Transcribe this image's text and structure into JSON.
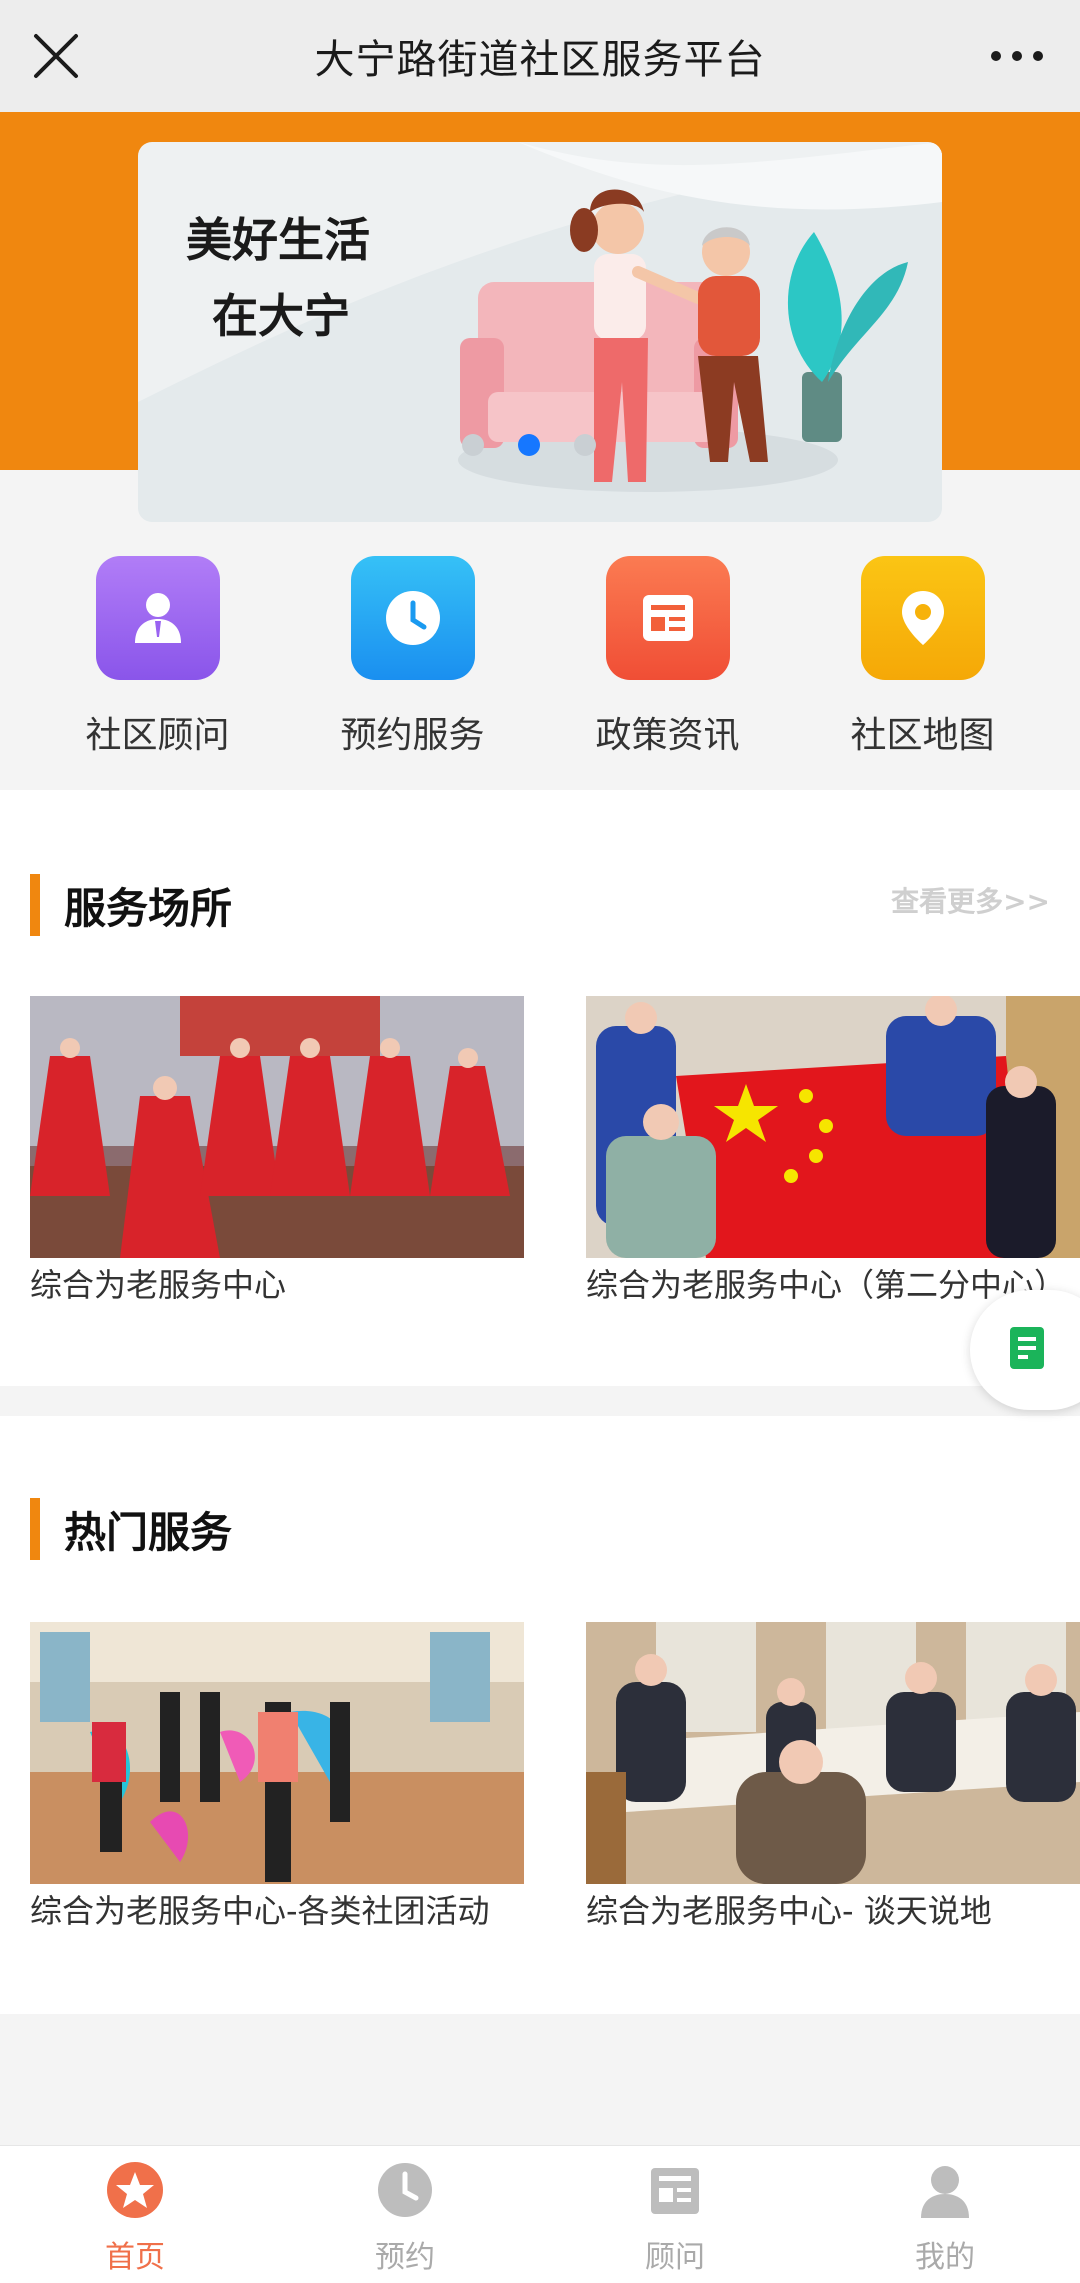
{
  "topbar": {
    "title": "大宁路街道社区服务平台",
    "close_icon": "close-icon",
    "more_icon": "more-icon"
  },
  "banner": {
    "line1": "美好生活",
    "line2": "在大宁",
    "slide_count": 3,
    "active_slide": 2,
    "colors": {
      "background": "#f0870f",
      "dot_active": "#1677ff"
    }
  },
  "quick_actions": [
    {
      "label": "社区顾问",
      "icon": "consultant-icon",
      "color": "#9a63f1"
    },
    {
      "label": "预约服务",
      "icon": "clock-icon",
      "color": "#1aa6f0"
    },
    {
      "label": "政策资讯",
      "icon": "news-icon",
      "color": "#f2603a"
    },
    {
      "label": "社区地图",
      "icon": "location-pin-icon",
      "color": "#f7b20a"
    }
  ],
  "venues": {
    "title": "服务场所",
    "more": "查看更多>>",
    "items": [
      {
        "caption": "综合为老服务中心"
      },
      {
        "caption": "综合为老服务中心（第二分中心）"
      }
    ]
  },
  "hot_services": {
    "title": "热门服务",
    "items": [
      {
        "caption": "综合为老服务中心-各类社团活动"
      },
      {
        "caption": "综合为老服务中心- 谈天说地"
      }
    ]
  },
  "tabbar": {
    "active_color": "#f0704a",
    "items": [
      {
        "label": "首页",
        "icon": "star-icon",
        "active": true
      },
      {
        "label": "预约",
        "icon": "clock-icon",
        "active": false
      },
      {
        "label": "顾问",
        "icon": "news-icon",
        "active": false
      },
      {
        "label": "我的",
        "icon": "user-icon",
        "active": false
      }
    ]
  }
}
